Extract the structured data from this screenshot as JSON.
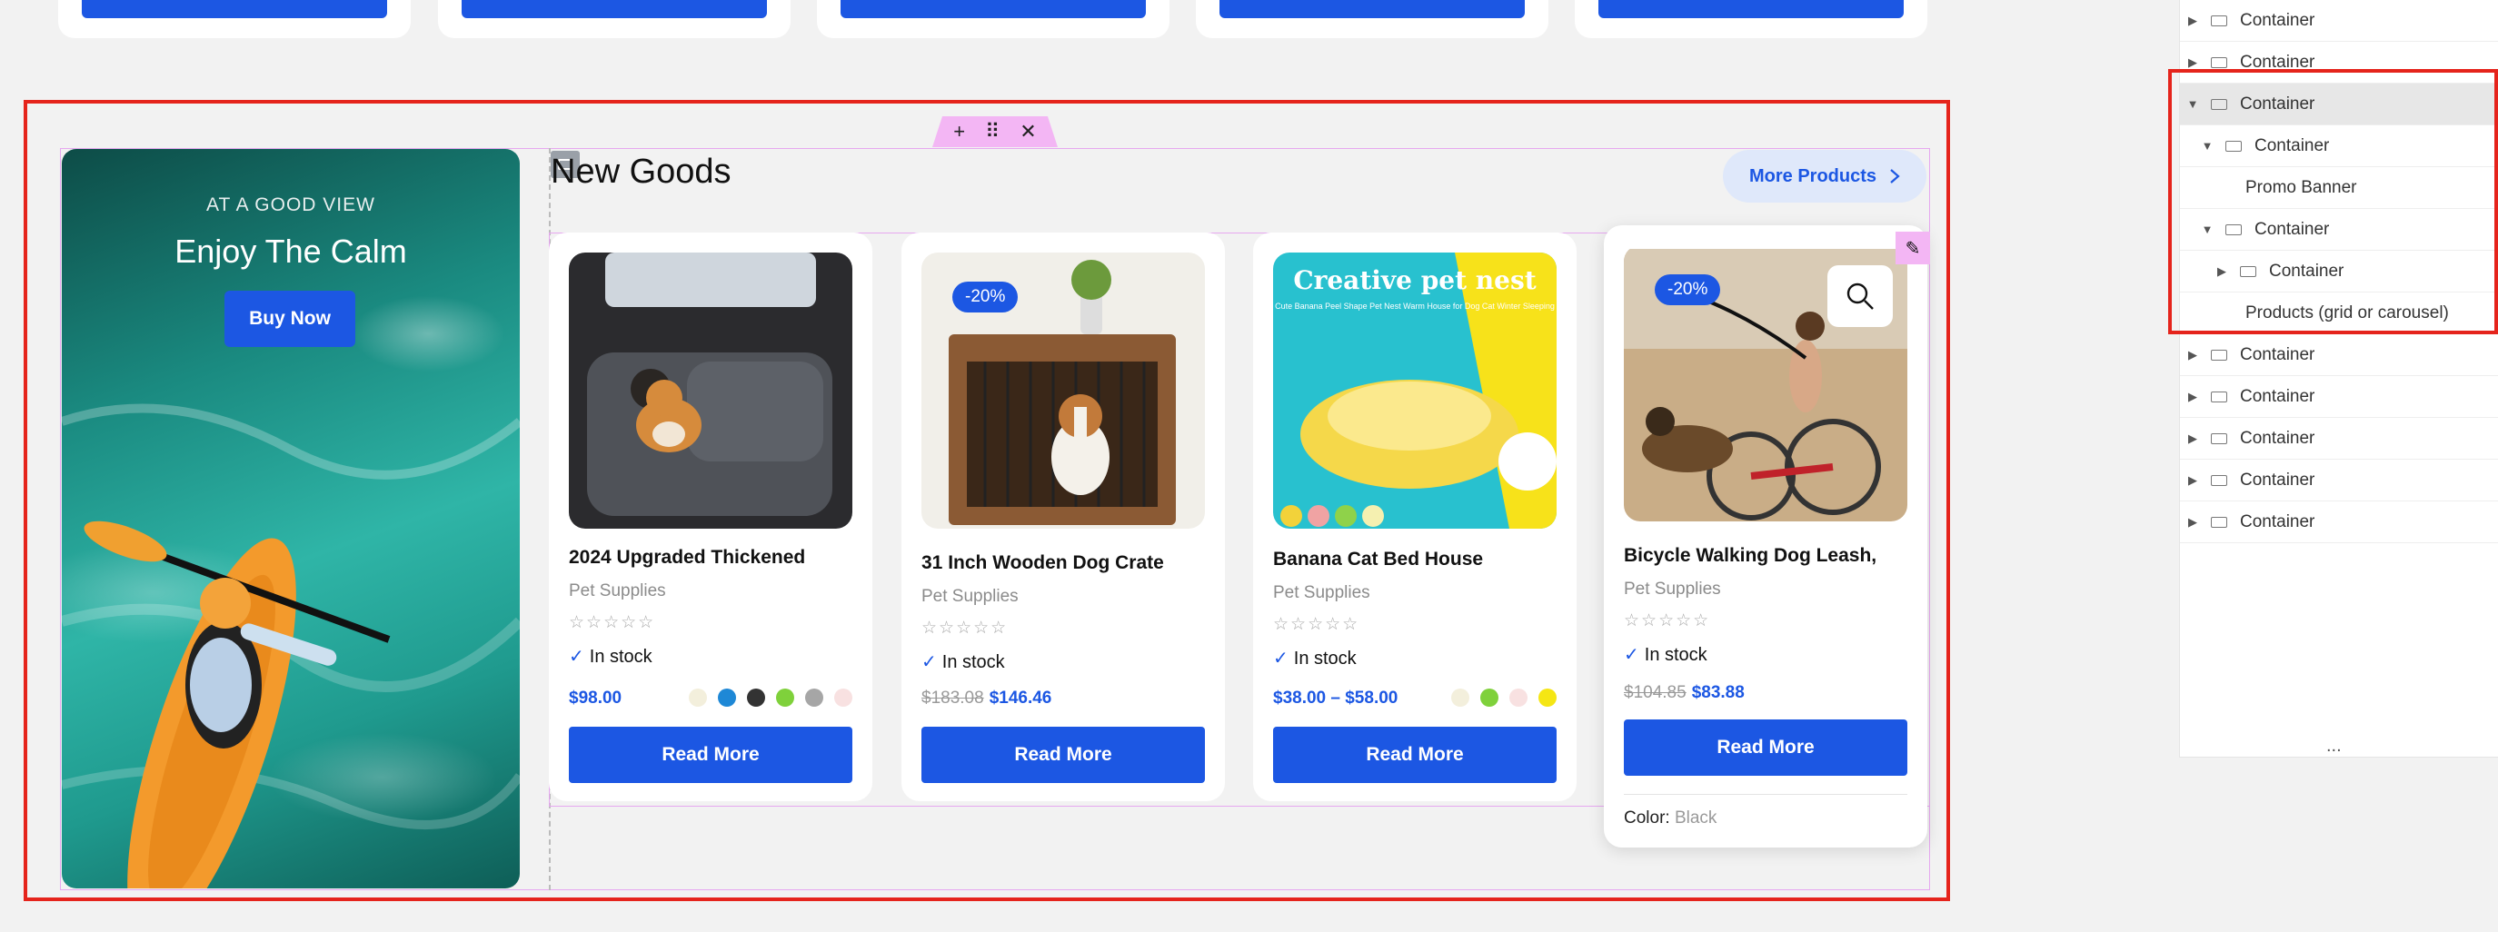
{
  "promo": {
    "subtitle": "AT A GOOD VIEW",
    "title": "Enjoy The Calm",
    "button": "Buy Now"
  },
  "section": {
    "title": "New Goods",
    "more_button": "More Products"
  },
  "products": [
    {
      "title": "2024 Upgraded Thickened",
      "category": "Pet Supplies",
      "stars": "☆☆☆☆☆",
      "stock": "In stock",
      "price": "$98.00",
      "old_price": "",
      "badge": "",
      "button": "Read More",
      "swatches": [
        "#f3efdc",
        "#1e88d6",
        "#333333",
        "#7fd13b",
        "#a6a6a6",
        "#f8e1e1"
      ]
    },
    {
      "title": "31 Inch Wooden Dog Crate",
      "category": "Pet Supplies",
      "stars": "☆☆☆☆☆",
      "stock": "In stock",
      "price": "$146.46",
      "old_price": "$183.08",
      "badge": "-20%",
      "button": "Read More",
      "swatches": []
    },
    {
      "title": "Banana Cat Bed House",
      "category": "Pet Supplies",
      "stars": "☆☆☆☆☆",
      "stock": "In stock",
      "price": "$38.00 – $58.00",
      "old_price": "",
      "badge": "",
      "button": "Read More",
      "image_text": "Creative pet nest",
      "image_subtext": "Cute Banana Peel Shape Pet Nest Warm House for Dog Cat Winter Sleeping",
      "swatches": [
        "#f3efdc",
        "#7fd13b",
        "#f8e1e1",
        "#f5e614"
      ]
    },
    {
      "title": "Bicycle Walking Dog Leash,",
      "category": "Pet Supplies",
      "stars": "☆☆☆☆☆",
      "stock": "In stock",
      "price": "$83.88",
      "old_price": "$104.85",
      "badge": "-20%",
      "button": "Read More",
      "color_label": "Color:",
      "color_value": "Black",
      "swatches": []
    }
  ],
  "toolbar": {
    "add": "+",
    "move": "⠿",
    "close": "✕"
  },
  "navigator": {
    "items": [
      {
        "label": "Container",
        "indent": 0,
        "expanded": false,
        "icon": true
      },
      {
        "label": "Container",
        "indent": 0,
        "expanded": false,
        "icon": true
      },
      {
        "label": "Container",
        "indent": 0,
        "expanded": true,
        "icon": true,
        "active": true
      },
      {
        "label": "Container",
        "indent": 1,
        "expanded": true,
        "icon": true
      },
      {
        "label": "Promo Banner",
        "indent": 2,
        "expanded": null,
        "icon": false
      },
      {
        "label": "Container",
        "indent": 1,
        "expanded": true,
        "icon": true
      },
      {
        "label": "Container",
        "indent": 2,
        "expanded": false,
        "icon": true
      },
      {
        "label": "Products (grid or carousel)",
        "indent": 2,
        "expanded": null,
        "icon": false
      },
      {
        "label": "Container",
        "indent": 0,
        "expanded": false,
        "icon": true
      },
      {
        "label": "Container",
        "indent": 0,
        "expanded": false,
        "icon": true
      },
      {
        "label": "Container",
        "indent": 0,
        "expanded": false,
        "icon": true
      },
      {
        "label": "Container",
        "indent": 0,
        "expanded": false,
        "icon": true
      },
      {
        "label": "Container",
        "indent": 0,
        "expanded": false,
        "icon": true
      }
    ],
    "more": "..."
  },
  "colors": {
    "accent": "#1c57e3",
    "selection": "#e5241c",
    "element_outline": "#e6a8f0"
  }
}
